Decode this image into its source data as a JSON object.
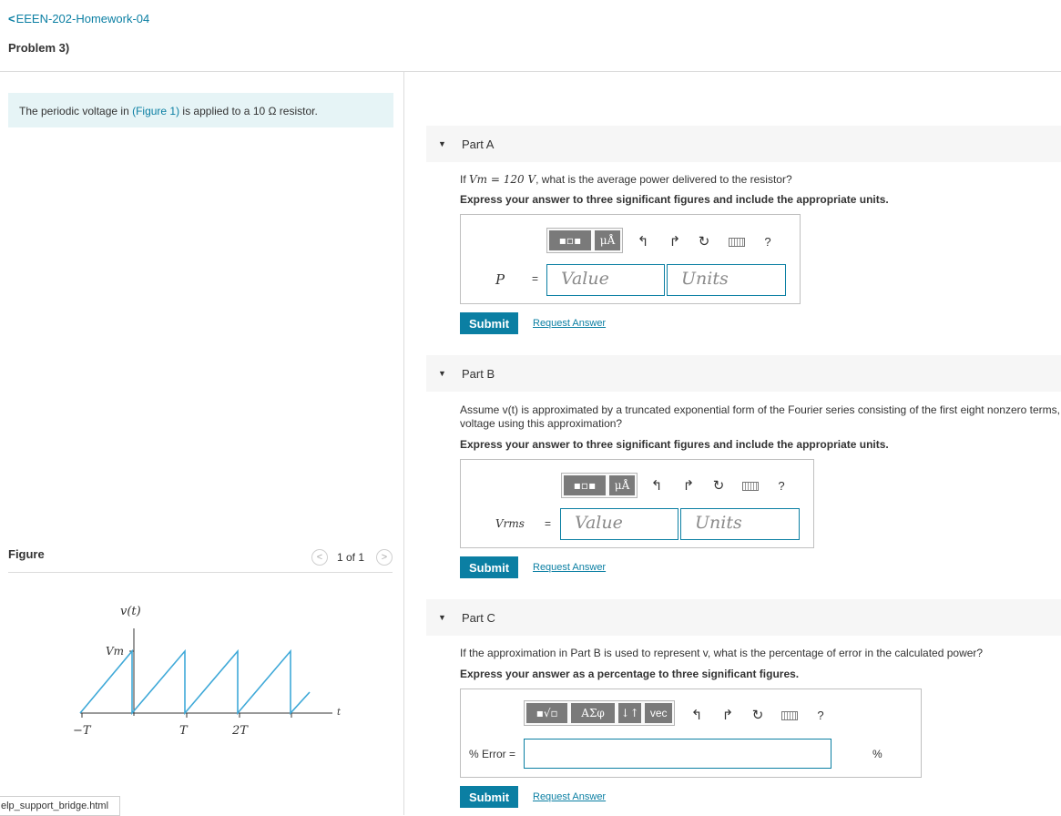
{
  "header": {
    "back_label": "EEEN-202-Homework-04",
    "problem_title": "Problem 3)"
  },
  "intro": {
    "prefix": "The periodic voltage in ",
    "figure_link": "(Figure 1)",
    "suffix": " is applied to a 10 Ω resistor."
  },
  "figure": {
    "label": "Figure",
    "pagination": "1 of 1",
    "prev_icon": "chevron-left-icon",
    "next_icon": "chevron-right-icon",
    "plot": {
      "y_label": "v(t)",
      "vm_label": "Vm",
      "t_label": "t",
      "ticks": [
        "−T",
        "T",
        "2T"
      ]
    }
  },
  "taskbar": {
    "file_label": "elp_support_bridge.html"
  },
  "parts": [
    {
      "title": "Part A",
      "question_prefix": "If ",
      "question_math": "Vm = 120 V",
      "question_suffix": ", what is the average power delivered to the resistor?",
      "instruction": "Express your answer to three significant figures and include the appropriate units.",
      "var_label": "P",
      "equals": "=",
      "value_placeholder": "Value",
      "units_placeholder": "Units",
      "toolbar_unit_btn": "μÅ",
      "help": "?",
      "submit": "Submit",
      "request": "Request Answer"
    },
    {
      "title": "Part B",
      "question_line1": "Assume v(t) is approximated by a truncated exponential form of the Fourier series consisting of the first eight nonzero terms, th",
      "question_line2": "voltage using this approximation?",
      "instruction": "Express your answer to three significant figures and include the appropriate units.",
      "var_label": "Vrms",
      "equals": "=",
      "value_placeholder": "Value",
      "units_placeholder": "Units",
      "toolbar_unit_btn": "μÅ",
      "help": "?",
      "submit": "Submit",
      "request": "Request Answer"
    },
    {
      "title": "Part C",
      "question": "If the approximation in Part B is used to represent v, what is the percentage of error in the calculated power?",
      "instruction": "Express your answer as a percentage to three significant figures.",
      "var_label": "% Error =",
      "unit_suffix": "%",
      "toolbar_greek": "ΑΣφ",
      "toolbar_arrows": "↓↑",
      "toolbar_vec": "vec",
      "help": "?",
      "submit": "Submit",
      "request": "Request Answer"
    }
  ],
  "colors": {
    "accent": "#0b7fa3",
    "intro_bg": "#e6f4f6",
    "plot_line": "#3fa9d8",
    "part_header_bg": "#f6f6f6"
  }
}
